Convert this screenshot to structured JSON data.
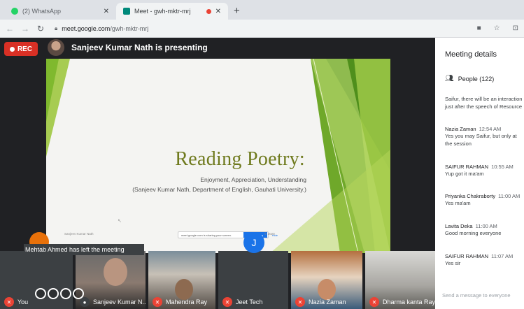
{
  "browser": {
    "tabs": [
      {
        "title": "(2) WhatsApp",
        "close": "✕"
      },
      {
        "title": "Meet - gwh-mktr-mrj",
        "close": "✕"
      }
    ],
    "new_tab": "+",
    "url_host": "meet.google.com",
    "url_path": "/gwh-mktr-mrj"
  },
  "meet": {
    "rec_label": "REC",
    "presenting": "Sanjeev Kumar Nath is presenting",
    "toast": "Mehtab Ahmed has left the meeting"
  },
  "slide": {
    "title": "Reading Poetry:",
    "subtitle": "Enjoyment, Appreciation, Understanding",
    "author": "(Sanjeev Kumar Nath, Department of English, Gauhati University.)",
    "footer_name": "Sanjeev Kumar Nath",
    "footer_date": "© 2020",
    "share_text": "meet.google.com is sharing your screen.",
    "stop_label": "Stop sharing",
    "hide_label": "Hide"
  },
  "participants": [
    {
      "name": "You"
    },
    {
      "name": "Sanjeev Kumar N..."
    },
    {
      "name": "Mahendra Ray"
    },
    {
      "name": "Jeet Tech",
      "initial": "J"
    },
    {
      "name": "Nazia Zaman"
    },
    {
      "name": "Dharma kanta Ray"
    }
  ],
  "panel": {
    "title": "Meeting details",
    "people_label": "People (122)",
    "messages": [
      {
        "sender": "",
        "time": "",
        "lines": [
          "Saifur, there will be an interaction",
          "just after the speech of Resource"
        ]
      },
      {
        "sender": "Nazia Zaman",
        "time": "12:54 AM",
        "lines": [
          "Yes you may Saifur, but only at",
          "the session"
        ]
      },
      {
        "sender": "SAIFUR RAHMAN",
        "time": "10:55 AM",
        "lines": [
          "Yup got it ma'am"
        ]
      },
      {
        "sender": "Priyanka Chakraborty",
        "time": "11:00 AM",
        "lines": [
          "Yes ma'am"
        ]
      },
      {
        "sender": "Lavita Deka",
        "time": "11:00 AM",
        "lines": [
          "Good morning everyone"
        ]
      },
      {
        "sender": "SAIFUR RAHMAN",
        "time": "11:07 AM",
        "lines": [
          "Yes sir"
        ]
      }
    ],
    "send_placeholder": "Send a message to everyone"
  },
  "colors": {
    "slide_green": "#7fb92e",
    "slide_title": "#6f7a1e",
    "rec_red": "#d93025",
    "avatar_blue": "#1a73e8"
  }
}
